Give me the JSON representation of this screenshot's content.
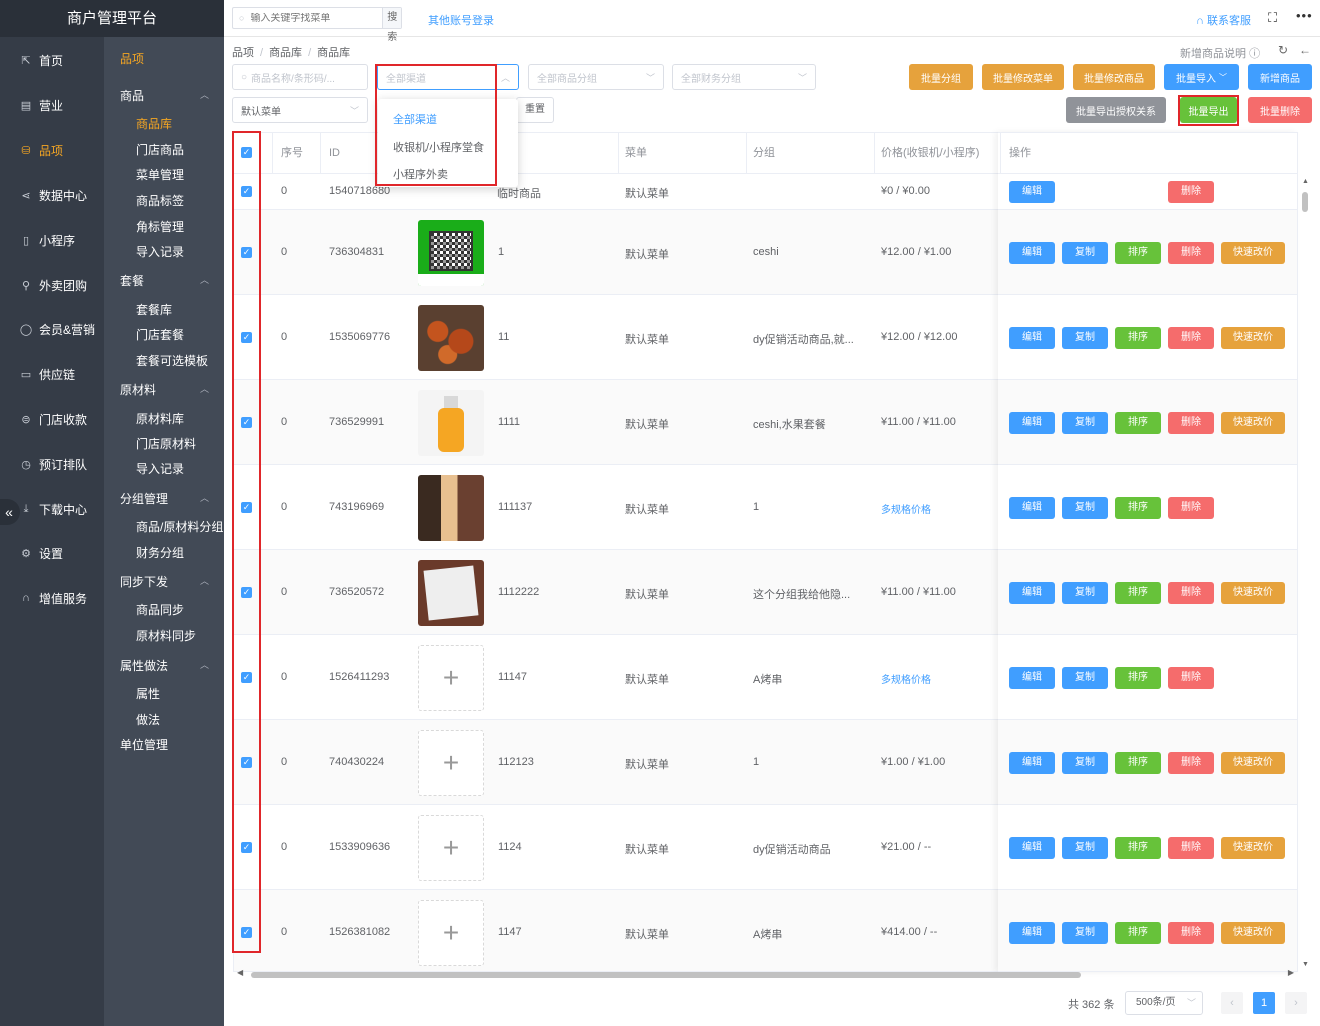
{
  "app": {
    "title": "商户管理平台"
  },
  "nav": [
    {
      "label": "首页",
      "icon": "share-icon"
    },
    {
      "label": "营业",
      "icon": "calendar-icon"
    },
    {
      "label": "品项",
      "icon": "bag-icon",
      "active": true
    },
    {
      "label": "数据中心",
      "icon": "share-nodes-icon"
    },
    {
      "label": "小程序",
      "icon": "phone-icon"
    },
    {
      "label": "外卖团购",
      "icon": "bike-icon"
    },
    {
      "label": "会员&营销",
      "icon": "user-icon"
    },
    {
      "label": "供应链",
      "icon": "truck-icon"
    },
    {
      "label": "门店收款",
      "icon": "coins-icon"
    },
    {
      "label": "预订排队",
      "icon": "clock-icon"
    },
    {
      "label": "下载中心",
      "icon": "download-icon"
    },
    {
      "label": "设置",
      "icon": "gear-icon"
    },
    {
      "label": "增值服务",
      "icon": "headset-icon"
    }
  ],
  "subnav": {
    "title": "品项",
    "groups": [
      {
        "label": "商品",
        "items": [
          "商品库",
          "门店商品",
          "菜单管理",
          "商品标签",
          "角标管理",
          "导入记录"
        ]
      },
      {
        "label": "套餐",
        "items": [
          "套餐库",
          "门店套餐",
          "套餐可选模板"
        ]
      },
      {
        "label": "原材料",
        "items": [
          "原材料库",
          "门店原材料",
          "导入记录"
        ]
      },
      {
        "label": "分组管理",
        "items": [
          "商品/原材料分组",
          "财务分组"
        ]
      },
      {
        "label": "同步下发",
        "items": [
          "商品同步",
          "原材料同步"
        ]
      },
      {
        "label": "属性做法",
        "items": [
          "属性",
          "做法"
        ]
      },
      {
        "label": "单位管理",
        "items": []
      }
    ]
  },
  "topbar": {
    "search_placeholder": "输入关键字找菜单",
    "search_button": "搜索",
    "other_login": "其他账号登录",
    "contact": "联系客服"
  },
  "breadcrumb": [
    "品项",
    "商品库",
    "商品库"
  ],
  "header_actions": {
    "help": "新增商品说明"
  },
  "filters": {
    "name_placeholder": "商品名称/条形码/...",
    "channel_placeholder": "全部渠道",
    "group_placeholder": "全部商品分组",
    "finance_placeholder": "全部财务分组",
    "menu_value": "默认菜单",
    "reset": "重置"
  },
  "channel_dropdown": [
    "全部渠道",
    "收银机/小程序堂食",
    "小程序外卖"
  ],
  "actions_row1": [
    "批量分组",
    "批量修改菜单",
    "批量修改商品",
    "批量导入",
    "新增商品"
  ],
  "actions_row2": [
    "批量导出授权关系",
    "批量导出",
    "批量删除"
  ],
  "table": {
    "headers": [
      "序号",
      "ID",
      "",
      "",
      "菜单",
      "分组",
      "价格(收银机/小程序)",
      "操作"
    ],
    "ops": {
      "edit": "编辑",
      "copy": "复制",
      "sort": "排序",
      "delete": "删除",
      "quick": "快速改价"
    },
    "rows": [
      {
        "seq": "0",
        "id": "1540718680",
        "name": "临时商品",
        "menu": "默认菜单",
        "group": "",
        "price": "¥0 / ¥0.00",
        "price_link": false,
        "thumb": "none",
        "ops": [
          "edit",
          "delete"
        ]
      },
      {
        "seq": "0",
        "id": "736304831",
        "name": "1",
        "menu": "默认菜单",
        "group": "ceshi",
        "price": "¥12.00 / ¥1.00",
        "price_link": false,
        "thumb": "qr",
        "ops": [
          "edit",
          "copy",
          "sort",
          "delete",
          "quick"
        ]
      },
      {
        "seq": "0",
        "id": "1535069776",
        "name": "11",
        "menu": "默认菜单",
        "group": "dy促销活动商品,就...",
        "price": "¥12.00 / ¥12.00",
        "price_link": false,
        "thumb": "food",
        "ops": [
          "edit",
          "copy",
          "sort",
          "delete",
          "quick"
        ]
      },
      {
        "seq": "0",
        "id": "736529991",
        "name": "1111",
        "menu": "默认菜单",
        "group": "ceshi,水果套餐",
        "price": "¥11.00 / ¥11.00",
        "price_link": false,
        "thumb": "bottle",
        "ops": [
          "edit",
          "copy",
          "sort",
          "delete",
          "quick"
        ]
      },
      {
        "seq": "0",
        "id": "743196969",
        "name": "111137",
        "menu": "默认菜单",
        "group": "1",
        "price": "多规格价格",
        "price_link": true,
        "thumb": "photo",
        "ops": [
          "edit",
          "copy",
          "sort",
          "delete"
        ]
      },
      {
        "seq": "0",
        "id": "736520572",
        "name": "1112222",
        "menu": "默认菜单",
        "group": "这个分组我给他隐...",
        "price": "¥11.00 / ¥11.00",
        "price_link": false,
        "thumb": "paper",
        "ops": [
          "edit",
          "copy",
          "sort",
          "delete",
          "quick"
        ]
      },
      {
        "seq": "0",
        "id": "1526411293",
        "name": "11147",
        "menu": "默认菜单",
        "group": "A烤串",
        "price": "多规格价格",
        "price_link": true,
        "thumb": "empty",
        "ops": [
          "edit",
          "copy",
          "sort",
          "delete"
        ]
      },
      {
        "seq": "0",
        "id": "740430224",
        "name": "112123",
        "menu": "默认菜单",
        "group": "1",
        "price": "¥1.00 / ¥1.00",
        "price_link": false,
        "thumb": "empty",
        "ops": [
          "edit",
          "copy",
          "sort",
          "delete",
          "quick"
        ]
      },
      {
        "seq": "0",
        "id": "1533909636",
        "name": "1124",
        "menu": "默认菜单",
        "group": "dy促销活动商品",
        "price": "¥21.00 / --",
        "price_link": false,
        "thumb": "empty",
        "ops": [
          "edit",
          "copy",
          "sort",
          "delete",
          "quick"
        ]
      },
      {
        "seq": "0",
        "id": "1526381082",
        "name": "1147",
        "menu": "默认菜单",
        "group": "A烤串",
        "price": "¥414.00 / --",
        "price_link": false,
        "thumb": "empty",
        "ops": [
          "edit",
          "copy",
          "sort",
          "delete",
          "quick"
        ]
      }
    ]
  },
  "pagination": {
    "total": "共 362 条",
    "page_size": "500条/页",
    "current": "1"
  },
  "colors": {
    "primary": "#409eff",
    "warning": "#e6a23c",
    "success": "#67c23a",
    "danger": "#f56c6c",
    "sidebar": "#353c47",
    "submenu": "#424a56",
    "highlight": "#e0262a"
  }
}
